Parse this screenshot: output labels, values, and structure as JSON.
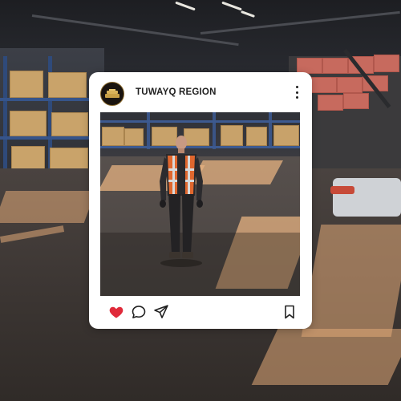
{
  "post": {
    "account_name": "TUWAYQ REGION",
    "avatar_icon": "logo-emblem",
    "menu_icon": "more-vertical-icon",
    "liked": true,
    "actions": {
      "like_icon": "heart-icon",
      "comment_icon": "comment-bubble-icon",
      "share_icon": "paper-plane-icon",
      "save_icon": "bookmark-icon"
    }
  },
  "colors": {
    "like": "#e02a3a",
    "card": "#ffffff",
    "text": "#1f1f1f",
    "vest": "#e0672e"
  }
}
